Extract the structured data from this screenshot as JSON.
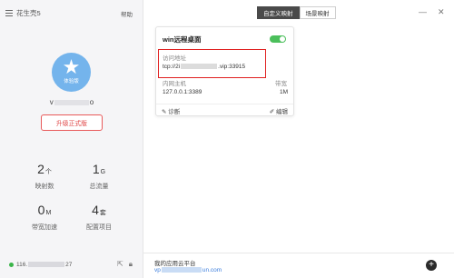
{
  "app": {
    "title": "花生壳5",
    "help_label": "帮助"
  },
  "user": {
    "badge": "体验版",
    "name_prefix": "v",
    "name_suffix": "o",
    "upgrade_label": "升级正式版"
  },
  "stats": [
    {
      "value": "2",
      "unit": "个",
      "label": "映射数"
    },
    {
      "value": "1",
      "unit": "G",
      "label": "总流量"
    },
    {
      "value": "0",
      "unit": "M",
      "label": "带宽加速"
    },
    {
      "value": "4",
      "unit": "套",
      "label": "配置项目"
    }
  ],
  "status": {
    "ip_prefix": "116.",
    "ip_suffix": "27",
    "color": "#3bb54a"
  },
  "tabs": [
    {
      "label": "自定义映射",
      "active": true
    },
    {
      "label": "场景映射",
      "active": false
    }
  ],
  "window": {
    "minimize": "—",
    "close": "✕"
  },
  "card": {
    "title": "win远程桌面",
    "enabled": true,
    "access_label": "访问地址",
    "access_prefix": "tcp://2i",
    "access_suffix": ".vip:33915",
    "host_label": "内网主机",
    "host_value": "127.0.0.1:3389",
    "bandwidth_label": "带宽",
    "bandwidth_value": "1M",
    "diagnose_label": "诊断",
    "edit_label": "编辑"
  },
  "bottom": {
    "title": "我的应用云平台",
    "link_prefix": "vp",
    "link_suffix": "un.com",
    "add_label": "+"
  },
  "colors": {
    "accent_red": "#e02020",
    "toggle_on": "#4bbf5b",
    "avatar": "#74b4ec",
    "link": "#3b7ddd"
  }
}
